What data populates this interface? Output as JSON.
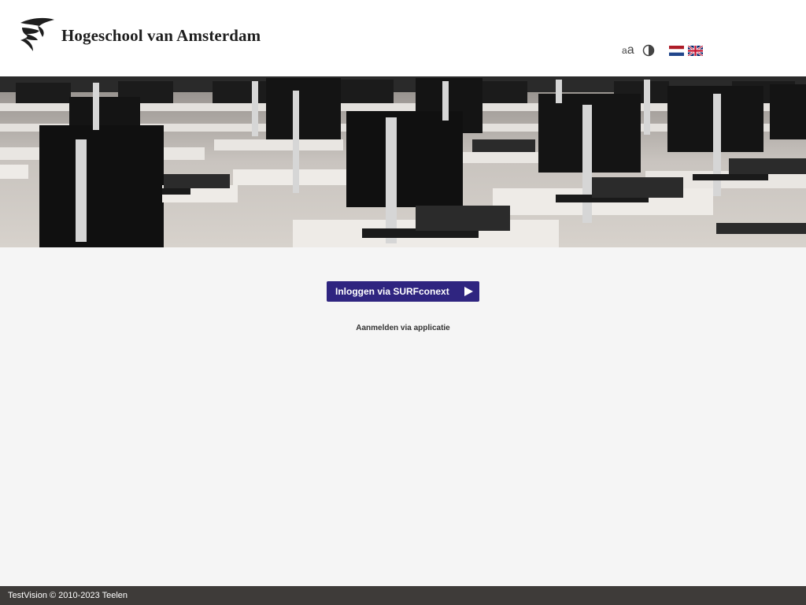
{
  "header": {
    "logo_text": "Hogeschool van Amsterdam",
    "logo_icon": "hva-logo-icon",
    "font_size_toggle": {
      "small": "a",
      "large": "a"
    },
    "contrast_icon": "contrast-icon",
    "languages": [
      {
        "code": "nl",
        "icon": "flag-nl-icon"
      },
      {
        "code": "en",
        "icon": "flag-uk-icon"
      }
    ]
  },
  "banner": {
    "subject": "computer-lab-photo"
  },
  "main": {
    "login_button_label": "Inloggen via SURFconext",
    "login_button_icon": "play-arrow-icon",
    "app_login_link": "Aanmelden via applicatie"
  },
  "footer": {
    "text": "TestVision © 2010-2023 Teelen"
  },
  "colors": {
    "primary_button": "#2f2580",
    "footer_bg": "#3e3b39",
    "page_bg": "#f5f5f5",
    "header_bg": "#ffffff"
  }
}
